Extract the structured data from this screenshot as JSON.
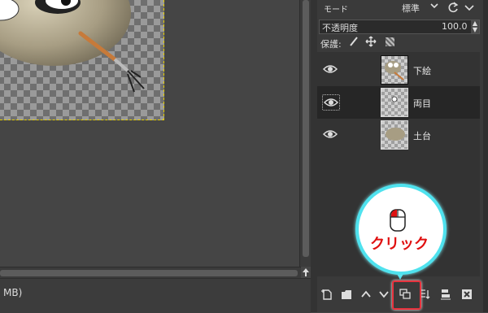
{
  "status": {
    "text": "MB)"
  },
  "layers_panel": {
    "mode_label": "モード",
    "mode_value": "標準",
    "opacity_label": "不透明度",
    "opacity_value": "100.0",
    "lock_label": "保護:",
    "layers": [
      {
        "name": "下絵",
        "visible": true,
        "selected": false
      },
      {
        "name": "両目",
        "visible": true,
        "selected": true
      },
      {
        "name": "土台",
        "visible": true,
        "selected": false
      }
    ]
  },
  "callout": {
    "text": "クリック"
  },
  "colors": {
    "accent_cyan": "#4fe2ee",
    "highlight_red": "#e8333e",
    "callout_text": "#e01010"
  }
}
